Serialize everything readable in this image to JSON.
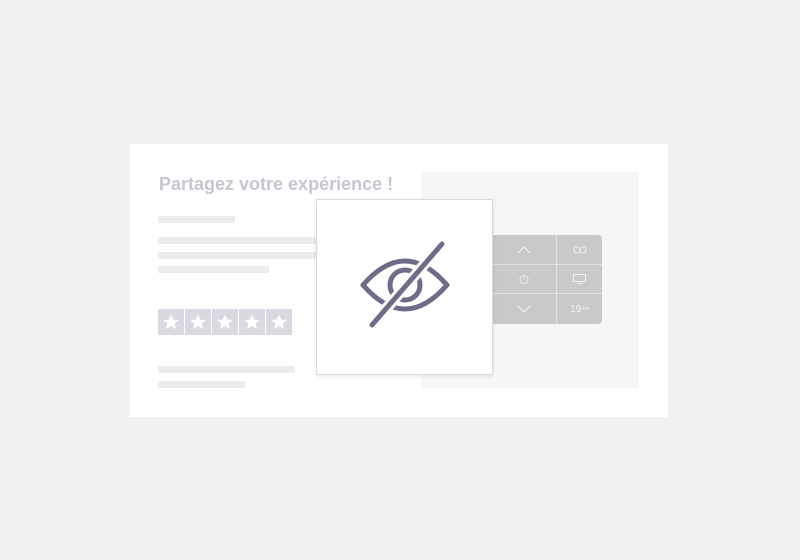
{
  "review_card": {
    "title": "Partagez votre expérience !",
    "rating": {
      "filled": 5,
      "max": 5,
      "icon": "star-icon"
    }
  },
  "device_remote": {
    "keys": [
      {
        "name": "up-arrow-key",
        "icon": "chevron-up-icon"
      },
      {
        "name": "loop-key",
        "icon": "infinity-icon"
      },
      {
        "name": "timer-key",
        "icon": "clock-icon"
      },
      {
        "name": "screen-key",
        "icon": "monitor-icon"
      },
      {
        "name": "down-arrow-key",
        "icon": "chevron-down-icon"
      },
      {
        "name": "speed-key",
        "value": "19",
        "unit": "km"
      }
    ]
  },
  "hidden_overlay": {
    "icon": "eye-off-icon"
  },
  "colors": {
    "background": "#f1f1f3",
    "card": "#ffffff",
    "title": "#c6c6d1",
    "skeleton": "#ececee",
    "star_box": "#d9d9e2",
    "remote": "#c9c9cb",
    "eye_icon": "#6e6d89"
  }
}
